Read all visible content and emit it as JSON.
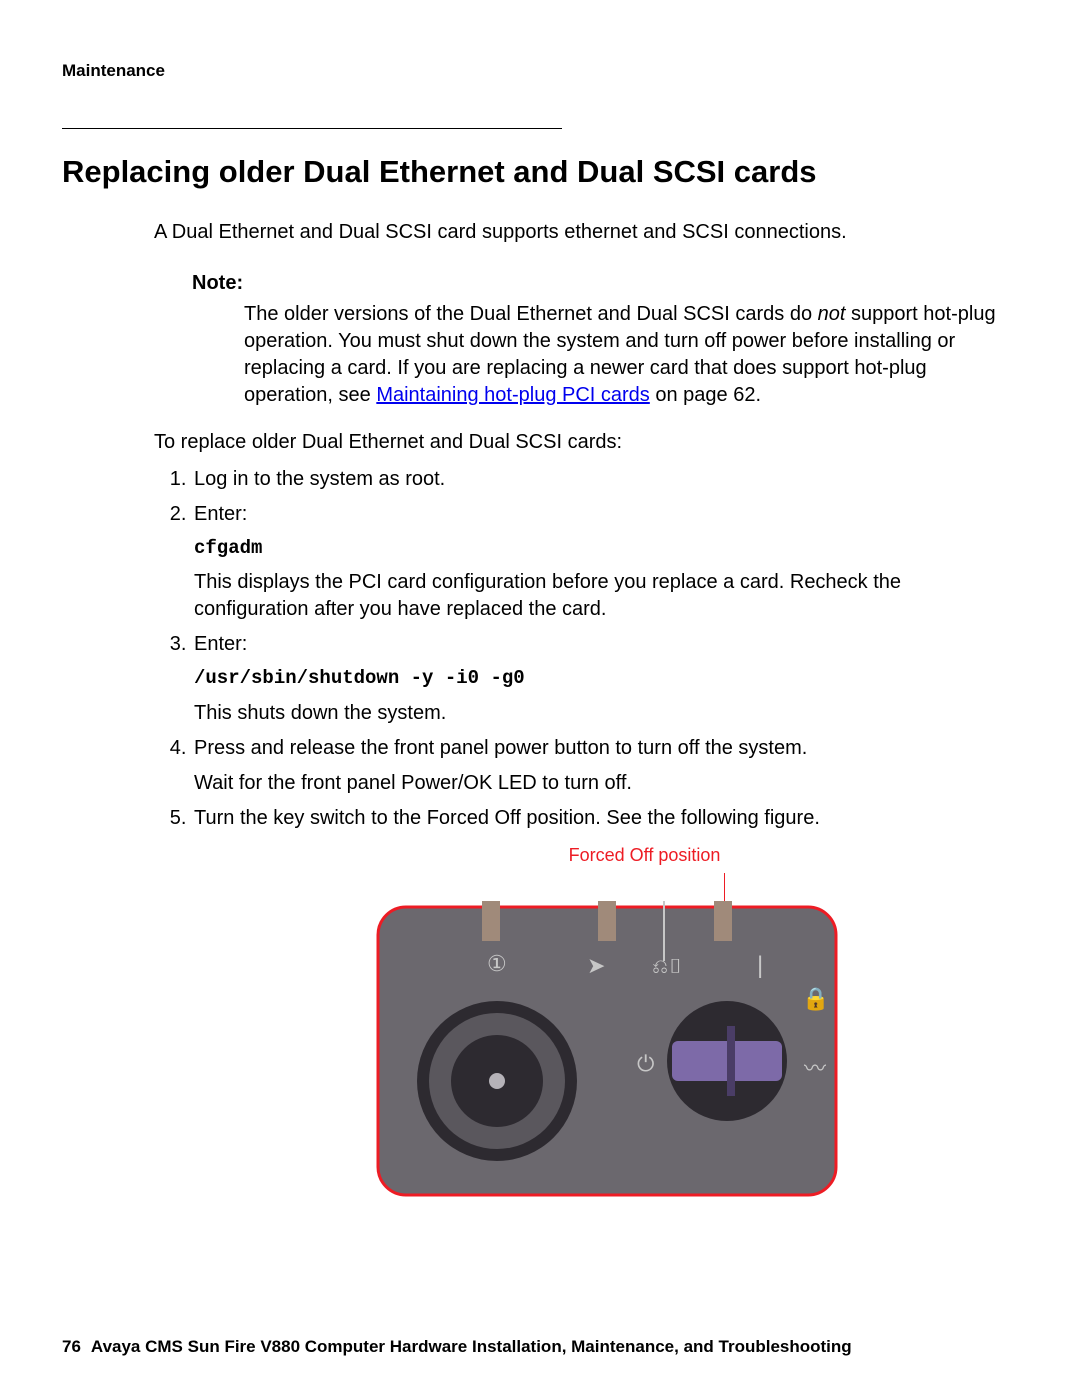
{
  "header": {
    "section": "Maintenance"
  },
  "title": "Replacing older Dual Ethernet and Dual SCSI cards",
  "intro": "A Dual Ethernet and Dual SCSI card supports ethernet and SCSI connections.",
  "note": {
    "label": "Note:",
    "text1": "The older versions of the Dual Ethernet and Dual SCSI cards do ",
    "emph": "not",
    "text2": " support hot-plug operation. You must shut down the system and turn off power before installing or replacing a card. If you are replacing a newer card that does support hot-plug operation, see ",
    "link": "Maintaining hot-plug PCI cards",
    "text3": " on page 62."
  },
  "lead": "To replace older Dual Ethernet and Dual SCSI cards:",
  "steps": {
    "s1": "Log in to the system as root.",
    "s2": {
      "a": "Enter:",
      "code": "cfgadm",
      "b": "This displays the PCI card configuration before you replace a card. Recheck the configuration after you have replaced the card."
    },
    "s3": {
      "a": "Enter:",
      "code": "/usr/sbin/shutdown -y -i0 -g0",
      "b": "This shuts down the system."
    },
    "s4": {
      "a": "Press and release the front panel power button to turn off the system.",
      "b": "Wait for the front panel Power/OK LED to turn off."
    },
    "s5": "Turn the key switch to the Forced Off position. See the following figure."
  },
  "figure": {
    "caption": "Forced Off position"
  },
  "footer": {
    "page": "76",
    "text": "Avaya CMS Sun Fire V880 Computer Hardware Installation, Maintenance, and Troubleshooting"
  }
}
